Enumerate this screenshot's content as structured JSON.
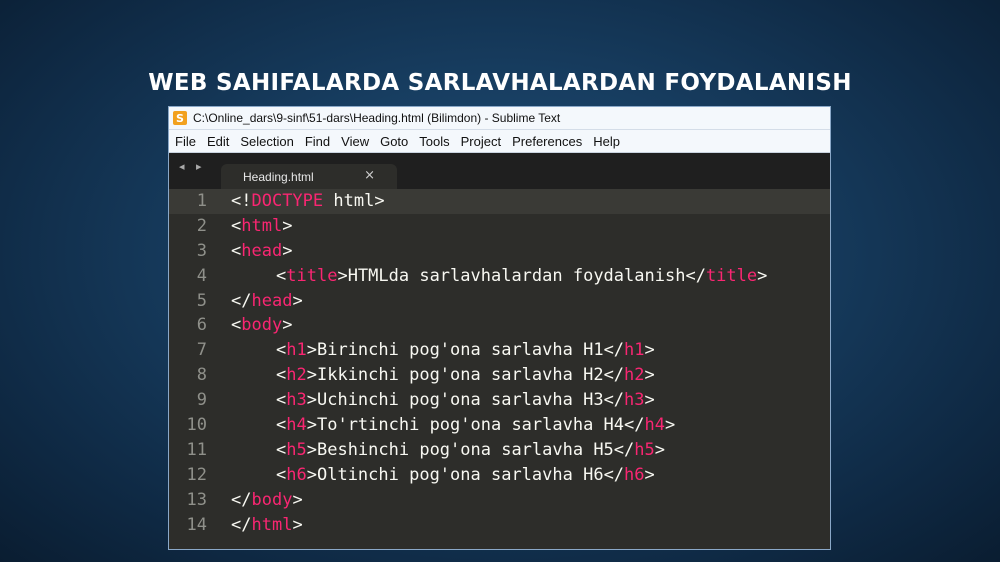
{
  "slide": {
    "title": "WEB SAHIFALARDA SARLAVHALARDAN FOYDALANISH"
  },
  "window": {
    "app_icon_glyph": "S",
    "title": "C:\\Online_dars\\9-sinf\\51-dars\\Heading.html (Bilimdon) - Sublime Text"
  },
  "menu": {
    "items": [
      "File",
      "Edit",
      "Selection",
      "Find",
      "View",
      "Goto",
      "Tools",
      "Project",
      "Preferences",
      "Help"
    ]
  },
  "tabs": {
    "nav_arrows": "◂ ▸",
    "active": {
      "label": "Heading.html",
      "close": "×"
    }
  },
  "colors": {
    "tag": "#f92672",
    "text": "#f8f8f2",
    "editor_bg": "#2d2d2a",
    "line_number": "#8f908a"
  },
  "code": {
    "lines": [
      {
        "no": "1",
        "indent": 0,
        "open": "<!",
        "tag": "DOCTYPE",
        "mid": " html>",
        "text": "",
        "close_open": "",
        "close_tag": "",
        "close_end": ""
      },
      {
        "no": "2",
        "indent": 0,
        "open": "<",
        "tag": "html",
        "mid": ">",
        "text": "",
        "close_open": "",
        "close_tag": "",
        "close_end": ""
      },
      {
        "no": "3",
        "indent": 0,
        "open": "<",
        "tag": "head",
        "mid": ">",
        "text": "",
        "close_open": "",
        "close_tag": "",
        "close_end": ""
      },
      {
        "no": "4",
        "indent": 1,
        "open": "<",
        "tag": "title",
        "mid": ">",
        "text": "HTMLda sarlavhalardan foydalanish",
        "close_open": "</",
        "close_tag": "title",
        "close_end": ">"
      },
      {
        "no": "5",
        "indent": 0,
        "open": "</",
        "tag": "head",
        "mid": ">",
        "text": "",
        "close_open": "",
        "close_tag": "",
        "close_end": ""
      },
      {
        "no": "6",
        "indent": 0,
        "open": "<",
        "tag": "body",
        "mid": ">",
        "text": "",
        "close_open": "",
        "close_tag": "",
        "close_end": ""
      },
      {
        "no": "7",
        "indent": 1,
        "open": "<",
        "tag": "h1",
        "mid": ">",
        "text": "Birinchi pog'ona sarlavha H1",
        "close_open": "</",
        "close_tag": "h1",
        "close_end": ">"
      },
      {
        "no": "8",
        "indent": 1,
        "open": "<",
        "tag": "h2",
        "mid": ">",
        "text": "Ikkinchi pog'ona sarlavha H2",
        "close_open": "</",
        "close_tag": "h2",
        "close_end": ">"
      },
      {
        "no": "9",
        "indent": 1,
        "open": "<",
        "tag": "h3",
        "mid": ">",
        "text": "Uchinchi pog'ona sarlavha H3",
        "close_open": "</",
        "close_tag": "h3",
        "close_end": ">"
      },
      {
        "no": "10",
        "indent": 1,
        "open": "<",
        "tag": "h4",
        "mid": ">",
        "text": "To'rtinchi pog'ona sarlavha H4",
        "close_open": "</",
        "close_tag": "h4",
        "close_end": ">"
      },
      {
        "no": "11",
        "indent": 1,
        "open": "<",
        "tag": "h5",
        "mid": ">",
        "text": "Beshinchi pog'ona sarlavha H5",
        "close_open": "</",
        "close_tag": "h5",
        "close_end": ">"
      },
      {
        "no": "12",
        "indent": 1,
        "open": "<",
        "tag": "h6",
        "mid": ">",
        "text": "Oltinchi pog'ona sarlavha H6",
        "close_open": "</",
        "close_tag": "h6",
        "close_end": ">"
      },
      {
        "no": "13",
        "indent": 0,
        "open": "</",
        "tag": "body",
        "mid": ">",
        "text": "",
        "close_open": "",
        "close_tag": "",
        "close_end": ""
      },
      {
        "no": "14",
        "indent": 0,
        "open": "</",
        "tag": "html",
        "mid": ">",
        "text": "",
        "close_open": "",
        "close_tag": "",
        "close_end": ""
      }
    ]
  }
}
